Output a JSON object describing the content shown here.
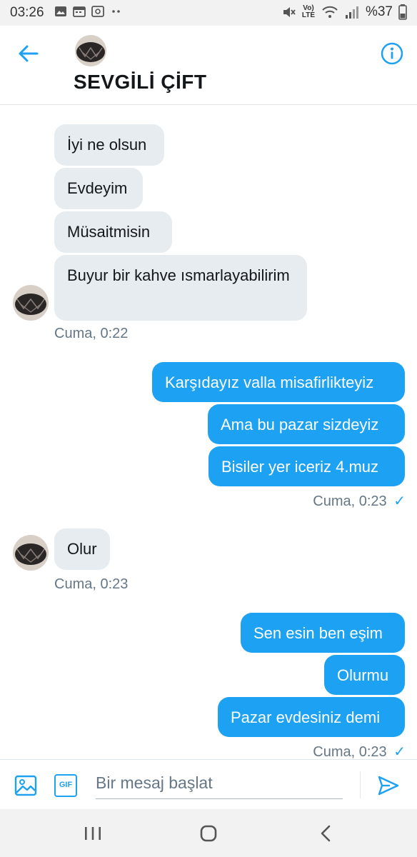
{
  "status_bar": {
    "time": "03:26",
    "network": "Vo) LTE",
    "battery": "%37"
  },
  "header": {
    "title": "SEVGİLİ ÇİFT"
  },
  "messages": [
    {
      "dir": "in",
      "text": "İyi ne olsun"
    },
    {
      "dir": "in",
      "text": "Evdeyim"
    },
    {
      "dir": "in",
      "text": "Müsaitmisin"
    },
    {
      "dir": "in",
      "text": "Buyur bir kahve ısmarlayabilirim"
    },
    {
      "dir": "out",
      "text": "Karşıdayız valla misafirlikteyiz"
    },
    {
      "dir": "out",
      "text": "Ama bu pazar sizdeyiz"
    },
    {
      "dir": "out",
      "text": "Bisiler yer iceriz 4.muz"
    },
    {
      "dir": "in",
      "text": "Olur"
    },
    {
      "dir": "out",
      "text": "Sen esin ben eşim"
    },
    {
      "dir": "out",
      "text": "Olurmu"
    },
    {
      "dir": "out",
      "text": "Pazar evdesiniz demi"
    }
  ],
  "timestamps": [
    {
      "text": "Cuma, 0:22"
    },
    {
      "text": "Cuma, 0:23",
      "read": "✓"
    },
    {
      "text": "Cuma, 0:23"
    },
    {
      "text": "Cuma, 0:23",
      "read": "✓"
    }
  ],
  "composer": {
    "placeholder": "Bir mesaj başlat",
    "gif_label": "GIF"
  },
  "colors": {
    "accent": "#1da1f2",
    "incoming_bubble": "#e6ecf0",
    "timestamp": "#657786"
  }
}
